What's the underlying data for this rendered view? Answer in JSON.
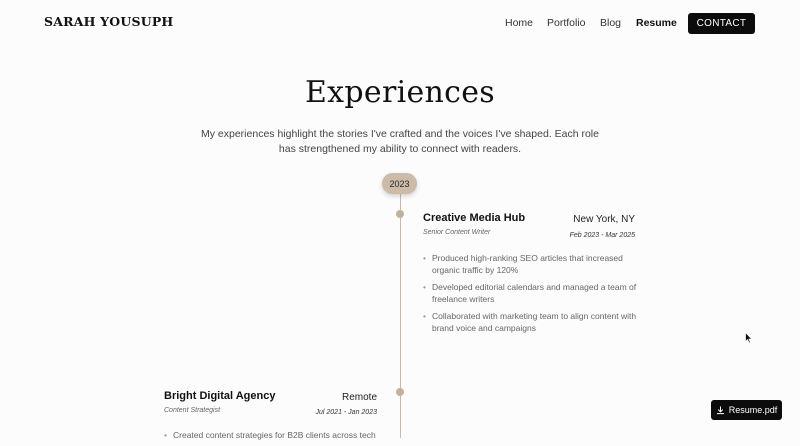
{
  "header": {
    "brand": "SARAH YOUSUPH",
    "nav": [
      "Home",
      "Portfolio",
      "Blog",
      "Resume"
    ],
    "active_nav": "Resume",
    "contact_label": "CONTACT"
  },
  "main": {
    "title": "Experiences",
    "intro": "My experiences highlight the stories I've crafted and the voices I've shaped. Each role has strengthened my ability to connect with readers."
  },
  "timeline": {
    "year": "2023",
    "entries": [
      {
        "company": "Creative Media Hub",
        "location": "New York, NY",
        "role": "Senior Content Writer",
        "dates": "Feb 2023 - Mar 2025",
        "bullets": [
          "Produced high-ranking SEO articles that increased organic traffic by 120%",
          "Developed editorial calendars and managed a team of freelance writers",
          "Collaborated with marketing team to align content with brand voice and campaigns"
        ]
      },
      {
        "company": "Bright Digital Agency",
        "location": "Remote",
        "role": "Content Strategist",
        "dates": "Jul 2021 - Jan 2023",
        "bullets": [
          "Created content strategies for B2B clients across tech"
        ]
      }
    ]
  },
  "floating": {
    "resume_button_label": "Resume.pdf",
    "resume_icon": "download-icon"
  },
  "colors": {
    "accent": "#cbbba8",
    "button_bg": "#0c0c0c"
  }
}
